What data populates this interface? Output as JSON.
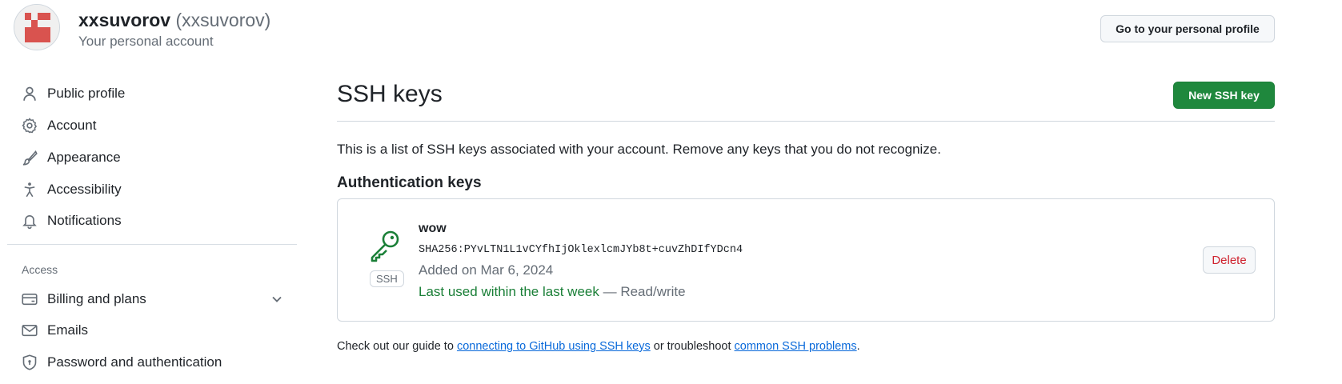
{
  "header": {
    "username": "xxsuvorov",
    "handle": "(xxsuvorov)",
    "subtitle": "Your personal account",
    "profile_button": "Go to your personal profile"
  },
  "sidebar": {
    "items": [
      {
        "label": "Public profile",
        "icon": "person-icon"
      },
      {
        "label": "Account",
        "icon": "gear-icon"
      },
      {
        "label": "Appearance",
        "icon": "paintbrush-icon"
      },
      {
        "label": "Accessibility",
        "icon": "accessibility-icon"
      },
      {
        "label": "Notifications",
        "icon": "bell-icon"
      }
    ],
    "access_heading": "Access",
    "access_items": [
      {
        "label": "Billing and plans",
        "icon": "credit-card-icon"
      },
      {
        "label": "Emails",
        "icon": "mail-icon"
      },
      {
        "label": "Password and authentication",
        "icon": "shield-icon"
      }
    ]
  },
  "main": {
    "title": "SSH keys",
    "new_key_button": "New SSH key",
    "intro": "This is a list of SSH keys associated with your account. Remove any keys that you do not recognize.",
    "auth_heading": "Authentication keys",
    "keys": [
      {
        "title": "wow",
        "fingerprint": "SHA256:PYvLTN1L1vCYfhIjOklexlcmJYb8t+cuvZhDIfYDcn4",
        "added": "Added on Mar 6, 2024",
        "last_used": "Last used within the last week",
        "separator": "—",
        "access": "Read/write",
        "type_label": "SSH",
        "delete_label": "Delete"
      }
    ],
    "footer": {
      "prefix": "Check out our guide to",
      "link1": "connecting to GitHub using SSH keys",
      "middle": "or troubleshoot",
      "link2": "common SSH problems",
      "suffix": "."
    }
  },
  "colors": {
    "primary_green": "#1f883d",
    "link_blue": "#0969da",
    "danger_red": "#cf222e",
    "avatar_red": "#d9534f"
  }
}
